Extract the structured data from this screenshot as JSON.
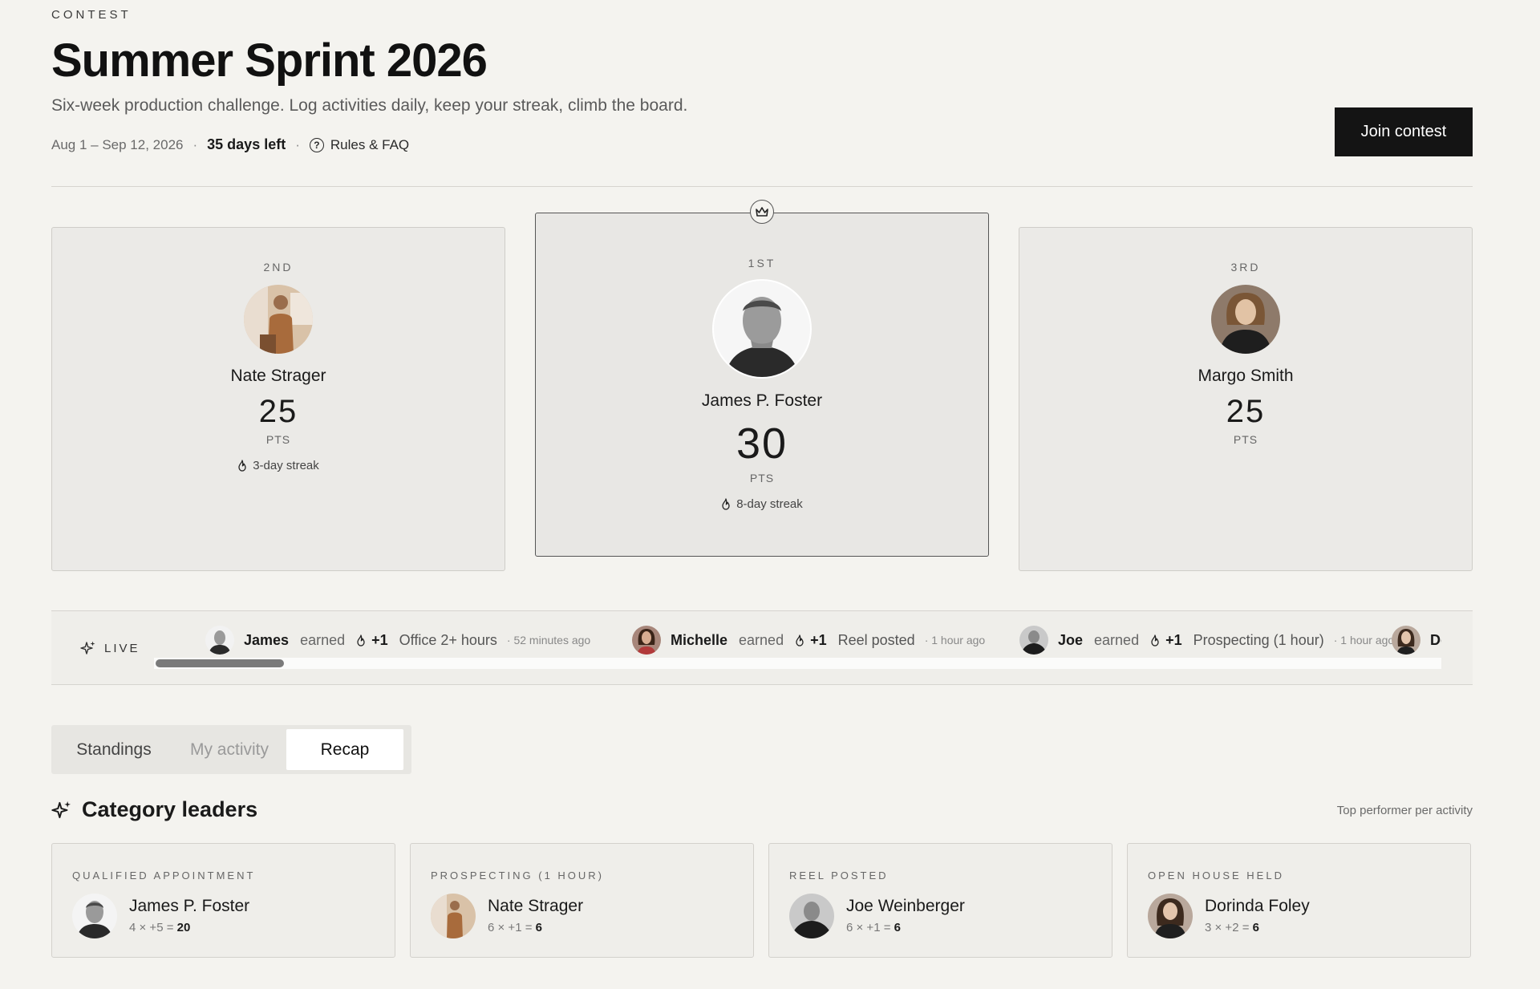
{
  "header": {
    "eyebrow": "CONTEST",
    "title": "Summer Sprint 2026",
    "subtitle": "Six-week production challenge. Log activities daily, keep your streak, climb the board.",
    "dates": "Aug 1 – Sep 12, 2026",
    "separator": "·",
    "days_left": "35 days left",
    "rules_label": "Rules & FAQ",
    "rules_icon_glyph": "?",
    "join_label": "Join contest"
  },
  "podium": {
    "first": {
      "rank": "1ST",
      "name": "James P. Foster",
      "points": "30",
      "pts_label": "PTS",
      "streak": "8-day streak",
      "icon": "crown-icon"
    },
    "second": {
      "rank": "2ND",
      "name": "Nate Strager",
      "points": "25",
      "pts_label": "PTS",
      "streak": "3-day streak"
    },
    "third": {
      "rank": "3RD",
      "name": "Margo Smith",
      "points": "25",
      "pts_label": "PTS"
    }
  },
  "live": {
    "label": "LIVE",
    "items": [
      {
        "who": "James",
        "verb": "earned",
        "gain": "+1",
        "activity": "Office 2+ hours",
        "when": "· 52 minutes ago"
      },
      {
        "who": "Michelle",
        "verb": "earned",
        "gain": "+1",
        "activity": "Reel posted",
        "when": "· 1 hour ago"
      },
      {
        "who": "Joe",
        "verb": "earned",
        "gain": "+1",
        "activity": "Prospecting (1 hour)",
        "when": "· 1 hour ago"
      },
      {
        "who": "Dori"
      }
    ]
  },
  "tabs": [
    {
      "label": "Standings"
    },
    {
      "label": "My activity"
    },
    {
      "label": "Recap",
      "selected": true
    }
  ],
  "category": {
    "title": "Category leaders",
    "note": "Top performer per activity",
    "cards": [
      {
        "label": "QUALIFIED APPOINTMENT",
        "name": "James P. Foster",
        "calc": "4 × +5 =",
        "total": "20"
      },
      {
        "label": "PROSPECTING (1 HOUR)",
        "name": "Nate Strager",
        "calc": "6 × +1 =",
        "total": "6"
      },
      {
        "label": "REEL POSTED",
        "name": "Joe Weinberger",
        "calc": "6 × +1 =",
        "total": "6"
      },
      {
        "label": "OPEN HOUSE HELD",
        "name": "Dorinda Foley",
        "calc": "3 × +2 =",
        "total": "6"
      }
    ]
  },
  "colors": {
    "background": "#f4f3ef",
    "accent": "#141414",
    "card": "#ebeae7"
  }
}
